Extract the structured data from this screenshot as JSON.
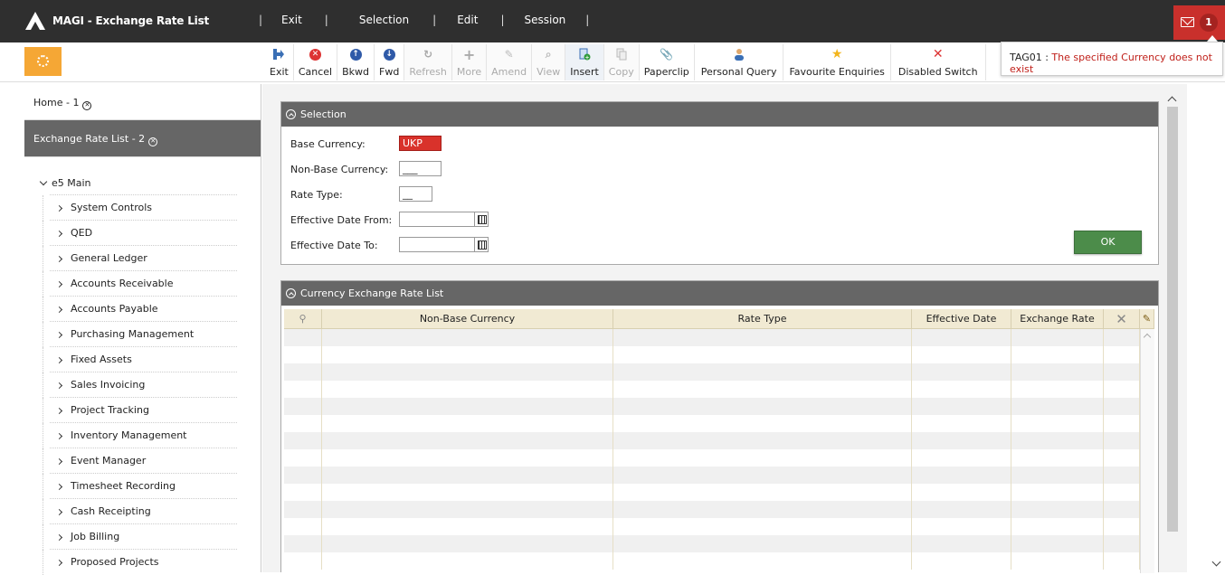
{
  "app": {
    "title": "MAGI - Exchange Rate List"
  },
  "menu": {
    "items": [
      "Exit",
      "Selection",
      "Edit",
      "Session"
    ]
  },
  "messages": {
    "count": "1"
  },
  "notification": {
    "code": "TAG01 : ",
    "message": "The specified Currency does not exist"
  },
  "toolbar": {
    "buttons": [
      {
        "label": "Exit",
        "icon": "exit-arrow-icon",
        "enabled": true
      },
      {
        "label": "Cancel",
        "icon": "cancel-circle-icon",
        "enabled": true
      },
      {
        "label": "Bkwd",
        "icon": "arrow-up-circle-icon",
        "enabled": true
      },
      {
        "label": "Fwd",
        "icon": "arrow-down-circle-icon",
        "enabled": true
      },
      {
        "label": "Refresh",
        "icon": "refresh-icon",
        "enabled": false
      },
      {
        "label": "More",
        "icon": "plus-icon",
        "enabled": false
      },
      {
        "label": "Amend",
        "icon": "pencil-icon",
        "enabled": false
      },
      {
        "label": "View",
        "icon": "magnifier-icon",
        "enabled": false
      },
      {
        "label": "Insert",
        "icon": "insert-doc-icon",
        "enabled": true
      },
      {
        "label": "Copy",
        "icon": "copy-icon",
        "enabled": false
      },
      {
        "label": "Paperclip",
        "icon": "paperclip-icon",
        "enabled": true
      },
      {
        "label": "Personal Query",
        "icon": "person-icon",
        "enabled": true
      },
      {
        "label": "Favourite Enquiries",
        "icon": "star-icon",
        "enabled": true
      },
      {
        "label": "Disabled Switch",
        "icon": "x-icon",
        "enabled": true
      }
    ]
  },
  "sidebar": {
    "tabs": [
      {
        "label": "Home - 1"
      },
      {
        "label": "Exchange Rate List - 2"
      }
    ],
    "tree_root": "e5 Main",
    "tree_items": [
      "System Controls",
      "QED",
      "General Ledger",
      "Accounts Receivable",
      "Accounts Payable",
      "Purchasing Management",
      "Fixed Assets",
      "Sales Invoicing",
      "Project Tracking",
      "Inventory Management",
      "Event Manager",
      "Timesheet Recording",
      "Cash Receipting",
      "Job Billing",
      "Proposed Projects"
    ]
  },
  "selection": {
    "title": "Selection",
    "base_currency_label": "Base Currency:",
    "base_currency_value": "UKP",
    "non_base_label": "Non-Base Currency:",
    "non_base_value": "___",
    "rate_type_label": "Rate Type:",
    "rate_type_value": "__",
    "date_from_label": "Effective Date From:",
    "date_from_value": "",
    "date_to_label": "Effective Date To:",
    "date_to_value": "",
    "ok_label": "OK"
  },
  "list": {
    "title": "Currency Exchange Rate List",
    "columns": [
      "Non-Base Currency",
      "Rate Type",
      "Effective Date",
      "Exchange Rate"
    ],
    "rows": []
  },
  "colors": {
    "topbar": "#2f2f2f",
    "error": "#d9322b",
    "ok": "#4c8c4a",
    "home": "#f5a735"
  }
}
